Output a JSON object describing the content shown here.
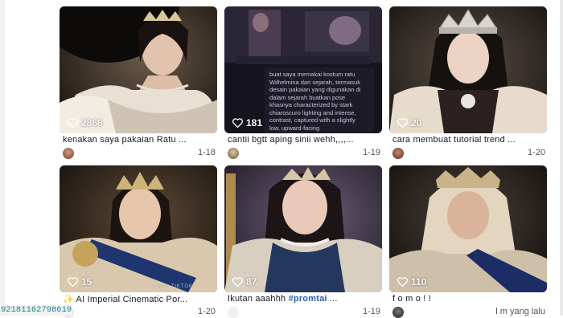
{
  "cards": [
    {
      "likes": "2866",
      "caption": "kenakan saya pakaian Ratu ...",
      "date": "1-18"
    },
    {
      "likes": "181",
      "caption": "cantii bgtt aping sinii wehh,,,,...",
      "date": "1-19",
      "overlay_text": "buat saya memakai kostum ratu Wilhelmina dari sejarah, termasuk desain pakaian yang digunakan di dalam sejarah buatkan pose khasnya characterized by stark chiaroscuro lighting and intense, contrast, captured with a slightly low, upward-facing"
    },
    {
      "likes": "20",
      "caption": "cara membuat tutorial trend ...",
      "date": "1-20"
    },
    {
      "likes": "15",
      "caption": "AI Imperial Cinematic Por...",
      "date": "1-20",
      "watermark": "INDRA TIKTOK"
    },
    {
      "likes": "87",
      "caption_text": "Ikutan aaahhh ",
      "caption_tag": "#promtai",
      "caption_tail": " ...",
      "date": "1-19"
    },
    {
      "likes": "110",
      "caption": "f o m o ! !",
      "date": "l m yang lalu"
    }
  ],
  "footer_id": "92181162798619",
  "colors": {
    "tag": "#2b5db9",
    "id_text": "#1b7f8f"
  }
}
